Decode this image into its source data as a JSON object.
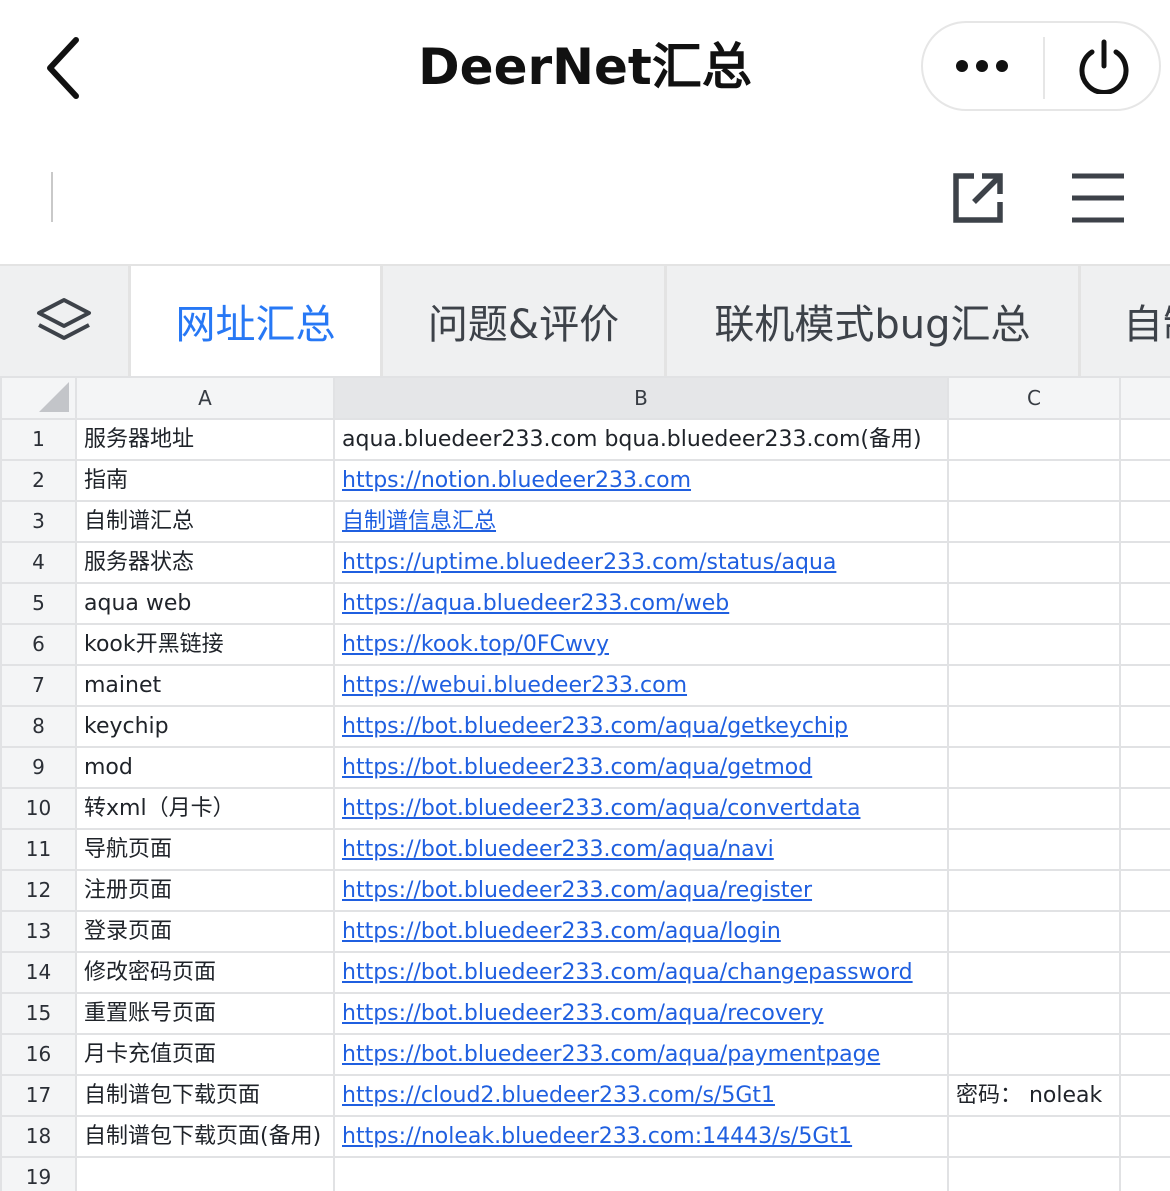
{
  "app": {
    "title": "DeerNet汇总"
  },
  "icons": {
    "back": "chevron-left-icon",
    "more": "more-dots-icon",
    "power": "power-icon",
    "share": "external-link-icon",
    "menu": "hamburger-menu-icon",
    "layers": "layers-icon"
  },
  "colors": {
    "accent": "#2778f5",
    "link": "#1f5fe0",
    "tab_bar": "#eff0f1",
    "header_bg": "#f4f5f6"
  },
  "tabs": [
    {
      "label": "网址汇总",
      "active": true
    },
    {
      "label": "问题&评价",
      "active": false
    },
    {
      "label": "联机模式bug汇总",
      "active": false
    },
    {
      "label": "自制",
      "active": false
    }
  ],
  "sheet": {
    "columns": [
      "A",
      "B",
      "C",
      ""
    ],
    "rows": [
      {
        "n": "1",
        "a": "服务器地址",
        "b": "aqua.bluedeer233.com  bqua.bluedeer233.com(备用)",
        "c": ""
      },
      {
        "n": "2",
        "a": "指南",
        "b": "https://notion.bluedeer233.com",
        "c": ""
      },
      {
        "n": "3",
        "a": "自制谱汇总",
        "b": "自制谱信息汇总",
        "c": ""
      },
      {
        "n": "4",
        "a": "服务器状态",
        "b": "https://uptime.bluedeer233.com/status/aqua",
        "c": ""
      },
      {
        "n": "5",
        "a": "aqua web",
        "b": "https://aqua.bluedeer233.com/web",
        "c": ""
      },
      {
        "n": "6",
        "a": "kook开黑链接",
        "b": "https://kook.top/0FCwvy",
        "c": ""
      },
      {
        "n": "7",
        "a": "mainet",
        "b": "https://webui.bluedeer233.com",
        "c": ""
      },
      {
        "n": "8",
        "a": "keychip",
        "b": "https://bot.bluedeer233.com/aqua/getkeychip",
        "c": ""
      },
      {
        "n": "9",
        "a": "mod",
        "b": "https://bot.bluedeer233.com/aqua/getmod",
        "c": ""
      },
      {
        "n": "10",
        "a": "转xml（月卡）",
        "b": "https://bot.bluedeer233.com/aqua/convertdata",
        "c": ""
      },
      {
        "n": "11",
        "a": "导航页面",
        "b": "https://bot.bluedeer233.com/aqua/navi",
        "c": ""
      },
      {
        "n": "12",
        "a": "注册页面",
        "b": "https://bot.bluedeer233.com/aqua/register",
        "c": ""
      },
      {
        "n": "13",
        "a": "登录页面",
        "b": "https://bot.bluedeer233.com/aqua/login",
        "c": ""
      },
      {
        "n": "14",
        "a": "修改密码页面",
        "b": "https://bot.bluedeer233.com/aqua/changepassword",
        "c": ""
      },
      {
        "n": "15",
        "a": "重置账号页面",
        "b": "https://bot.bluedeer233.com/aqua/recovery",
        "c": ""
      },
      {
        "n": "16",
        "a": "月卡充值页面",
        "b": "https://bot.bluedeer233.com/aqua/paymentpage",
        "c": ""
      },
      {
        "n": "17",
        "a": "自制谱包下载页面",
        "b": "https://cloud2.bluedeer233.com/s/5Gt1",
        "c": "密码：  noleak"
      },
      {
        "n": "18",
        "a": "自制谱包下载页面(备用)",
        "b": "https://noleak.bluedeer233.com:14443/s/5Gt1",
        "c": ""
      },
      {
        "n": "19",
        "a": "",
        "b": "",
        "c": ""
      }
    ]
  }
}
